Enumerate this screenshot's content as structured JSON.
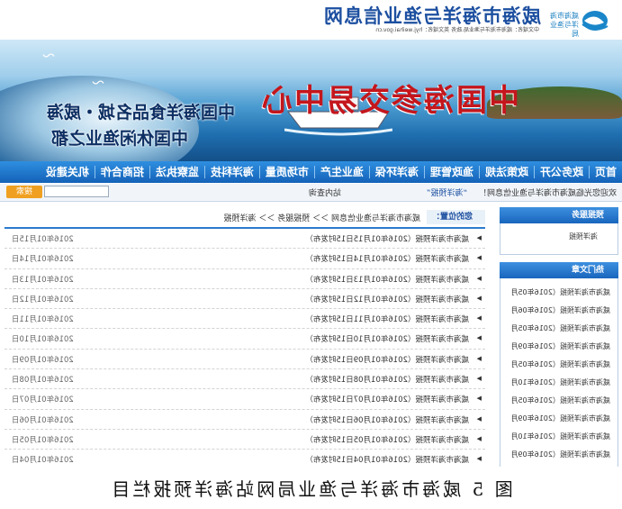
{
  "header": {
    "site_title": "威海市海洋与渔业信息网",
    "subtitle": "中文域名：威海市海洋与渔业局.政务  英文域名：hyj.weihai.gov.cn",
    "logo_text": "威海市海洋与渔业局"
  },
  "banner": {
    "main_text": "中国海参交易中心",
    "line1": "中国海洋食品名城・威海",
    "line2": "中国休闲渔业之都"
  },
  "nav": [
    "首页",
    "政务公开",
    "政策法规",
    "渔政管理",
    "海洋环保",
    "渔业生产",
    "市场质量",
    "海洋科技",
    "监察执法",
    "招商合作",
    "机关建设"
  ],
  "toolbar": {
    "welcome": "欢迎您光临威海市海洋与渔业信息网！",
    "notice": "“海洋预报”",
    "search_label": "站内查询",
    "search_button": "搜索"
  },
  "sidebar": {
    "service_title": "预报服务",
    "service_link": "海洋预报",
    "hot_title": "热门文章",
    "hot_items": [
      "威海市海洋预报（2016年05月",
      "威海市海洋预报（2016年06月",
      "威海市海洋预报（2016年05月",
      "威海市海洋预报（2016年09月",
      "威海市海洋预报（2016年05月",
      "威海市海洋预报（2016年10月",
      "威海市海洋预报（2016年05月",
      "威海市海洋预报（2016年09月",
      "威海市海洋预报（2016年10月",
      "威海市海洋预报（2016年09月"
    ]
  },
  "main": {
    "location_tag": "您的位置：",
    "breadcrumb": "威海市海洋与渔业信息网 ＞＞ 预报服务 ＞＞ 海洋预报",
    "rows": [
      {
        "title": "威海市海洋预报（2016年01月15日15时发布）",
        "date": "2016年01月15日"
      },
      {
        "title": "威海市海洋预报（2016年01月14日15时发布）",
        "date": "2016年01月14日"
      },
      {
        "title": "威海市海洋预报（2016年01月13日15时发布）",
        "date": "2016年01月13日"
      },
      {
        "title": "威海市海洋预报（2016年01月12日15时发布）",
        "date": "2016年01月12日"
      },
      {
        "title": "威海市海洋预报（2016年01月11日15时发布）",
        "date": "2016年01月11日"
      },
      {
        "title": "威海市海洋预报（2016年01月10日15时发布）",
        "date": "2016年01月10日"
      },
      {
        "title": "威海市海洋预报（2016年01月09日15时发布）",
        "date": "2016年01月09日"
      },
      {
        "title": "威海市海洋预报（2016年01月08日15时发布）",
        "date": "2016年01月08日"
      },
      {
        "title": "威海市海洋预报（2016年01月07日15时发布）",
        "date": "2016年01月07日"
      },
      {
        "title": "威海市海洋预报（2016年01月06日15时发布）",
        "date": "2016年01月06日"
      },
      {
        "title": "威海市海洋预报（2016年01月05日15时发布）",
        "date": "2016年01月05日"
      },
      {
        "title": "威海市海洋预报（2016年01月04日15时发布）",
        "date": "2016年01月04日"
      }
    ]
  },
  "caption": "图 5 威海市海洋与渔业局网站海洋预报栏目"
}
